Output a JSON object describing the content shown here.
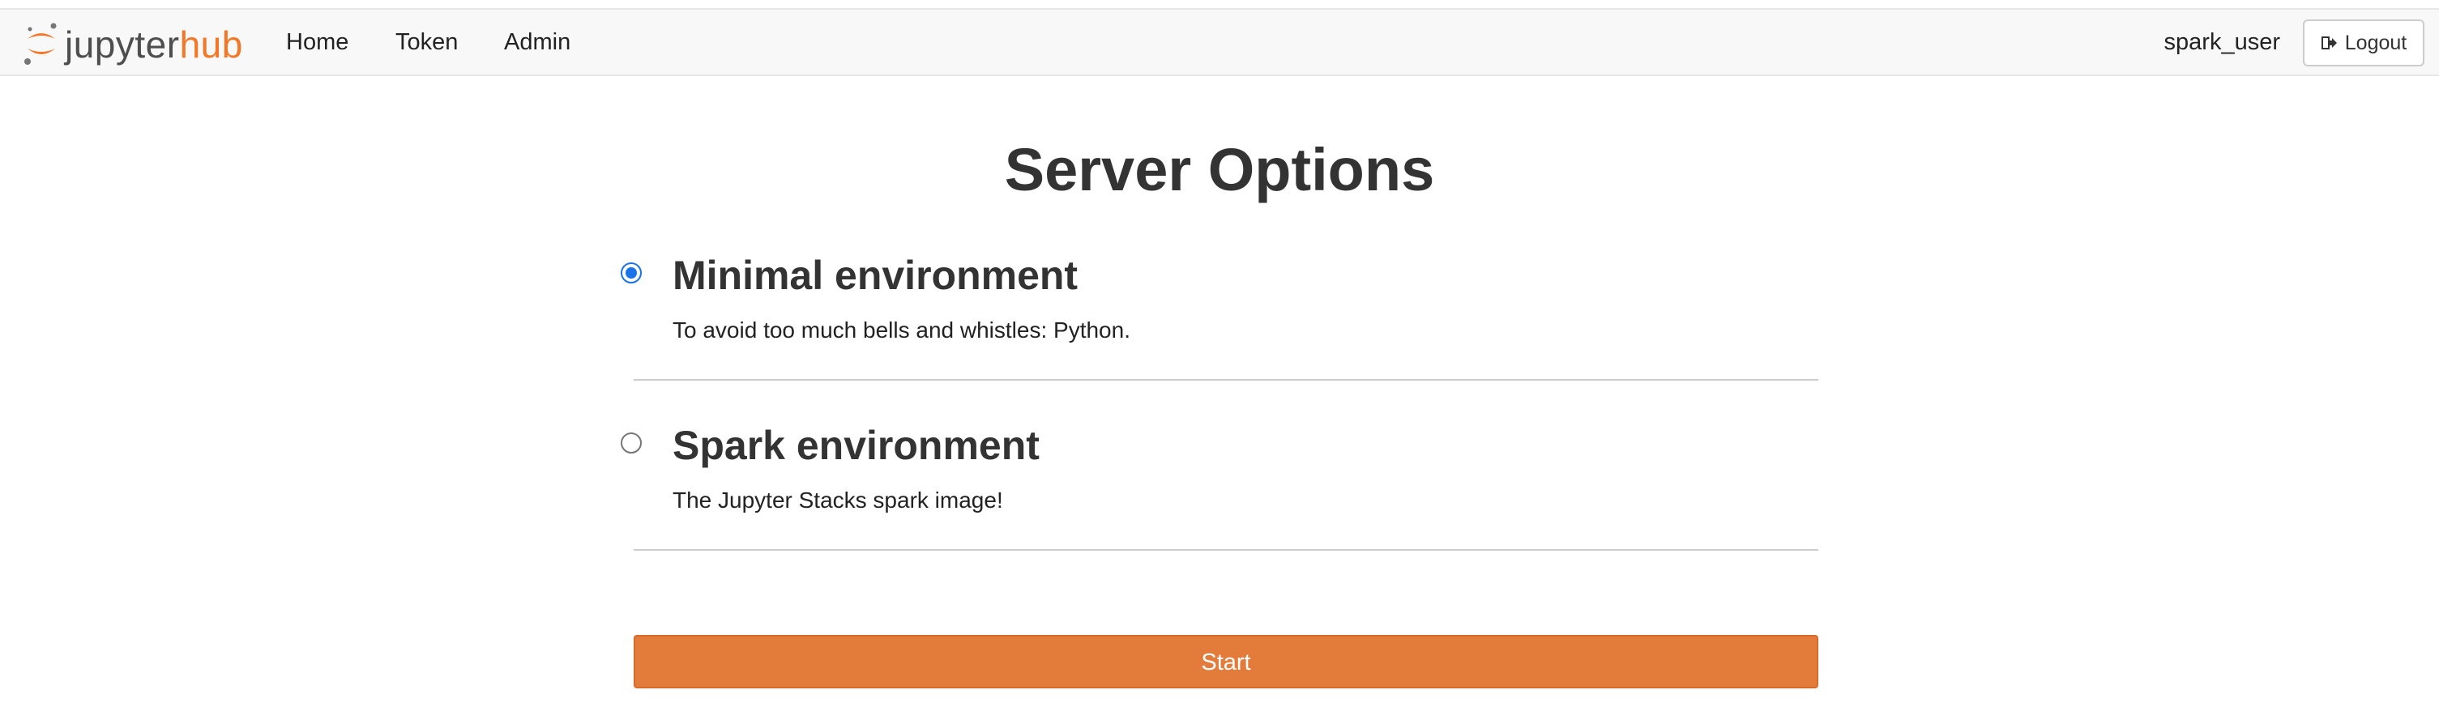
{
  "navbar": {
    "logo": {
      "word_main": "jupyter",
      "word_accent": "hub",
      "icon": "jupyter-logo-icon"
    },
    "links": [
      {
        "label": "Home"
      },
      {
        "label": "Token"
      },
      {
        "label": "Admin"
      }
    ],
    "username": "spark_user",
    "logout_label": "Logout",
    "logout_icon": "sign-out-icon"
  },
  "page": {
    "title": "Server Options"
  },
  "options": [
    {
      "title": "Minimal environment",
      "description": "To avoid too much bells and whistles: Python.",
      "selected": true
    },
    {
      "title": "Spark environment",
      "description": "The Jupyter Stacks spark image!",
      "selected": false
    }
  ],
  "start_button": {
    "label": "Start"
  },
  "colors": {
    "accent": "#f37726",
    "start_button": "#e37b3b",
    "radio_selected": "#1a73e8",
    "navbar_bg": "#f8f8f8"
  }
}
